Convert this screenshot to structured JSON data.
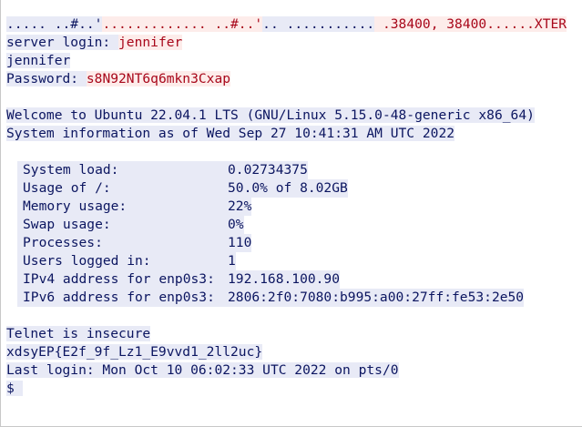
{
  "terminal": {
    "top_line": {
      "left": "..... ..#..'",
      "mid_red": "............. ..#..'",
      "mid": ".. ...........",
      "right_red": " .38400, 38400......XTER"
    },
    "server_login_label": "server login: ",
    "server_login_value": "jennifer",
    "echo_user": "jennifer",
    "password_label": "Password: ",
    "password_value": "s8N92NT6q6mkn3Cxap",
    "welcome": "Welcome to Ubuntu 22.04.1 LTS (GNU/Linux 5.15.0-48-generic x86_64)",
    "system_info": "System information as of Wed Sep 27 10:41:31 AM UTC 2022",
    "stats": [
      {
        "label": "System load:",
        "value": "0.02734375"
      },
      {
        "label": "Usage of /:",
        "value": "50.0% of 8.02GB"
      },
      {
        "label": "Memory usage:",
        "value": "22%"
      },
      {
        "label": "Swap usage:",
        "value": "0%"
      },
      {
        "label": "Processes:",
        "value": "110"
      },
      {
        "label": "Users logged in:",
        "value": "1"
      },
      {
        "label": "IPv4 address for enp0s3:",
        "value": "192.168.100.90"
      },
      {
        "label": "IPv6 address for enp0s3:",
        "value": "2806:2f0:7080:b995:a00:27ff:fe53:2e50"
      }
    ],
    "telnet_warning": "Telnet is insecure",
    "flag": "xdsyEP{E2f_9f_Lz1_E9vvd1_2ll2uc}",
    "last_login": "Last login: Mon Oct 10 06:02:33 UTC 2022 on pts/0",
    "prompt": "$ "
  }
}
